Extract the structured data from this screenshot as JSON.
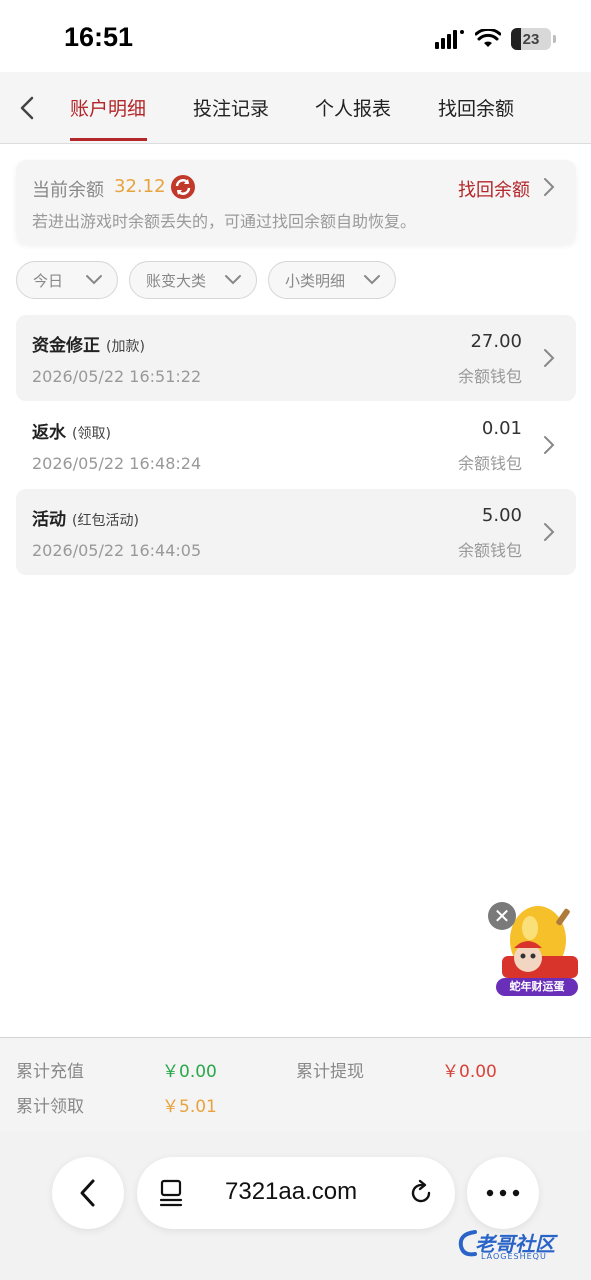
{
  "status_bar": {
    "time": "16:51",
    "battery": "23"
  },
  "tabs": [
    {
      "label": "账户明细",
      "active": true
    },
    {
      "label": "投注记录",
      "active": false
    },
    {
      "label": "个人报表",
      "active": false
    },
    {
      "label": "找回余额",
      "active": false
    }
  ],
  "balance": {
    "label": "当前余额",
    "value": "32.12",
    "recover_label": "找回余额",
    "hint": "若进出游戏时余额丢失的，可通过找回余额自助恢复。"
  },
  "filters": [
    {
      "label": "今日"
    },
    {
      "label": "账变大类"
    },
    {
      "label": "小类明细"
    }
  ],
  "records": [
    {
      "title": "资金修正",
      "sub": "(加款)",
      "time": "2026/05/22 16:51:22",
      "amount": "27.00",
      "wallet": "余额钱包"
    },
    {
      "title": "返水",
      "sub": "(领取)",
      "time": "2026/05/22 16:48:24",
      "amount": "0.01",
      "wallet": "余额钱包"
    },
    {
      "title": "活动",
      "sub": "(红包活动)",
      "time": "2026/05/22 16:44:05",
      "amount": "5.00",
      "wallet": "余额钱包"
    }
  ],
  "promo": {
    "label": "蛇年财运蛋",
    "close_glyph": "✕"
  },
  "totals": {
    "recharge_label": "累计充值",
    "recharge_value": "￥0.00",
    "withdraw_label": "累计提现",
    "withdraw_value": "￥0.00",
    "claim_label": "累计领取",
    "claim_value": "￥5.01"
  },
  "browser": {
    "url": "7321aa.com"
  },
  "watermark": {
    "text": "老哥社区",
    "sub": "LAOGESHEQU"
  },
  "colors": {
    "accent": "#b3262a",
    "balance": "#e8a33d",
    "recharge": "#2aa84a",
    "withdraw": "#d9423a",
    "claim": "#e8a33d"
  }
}
